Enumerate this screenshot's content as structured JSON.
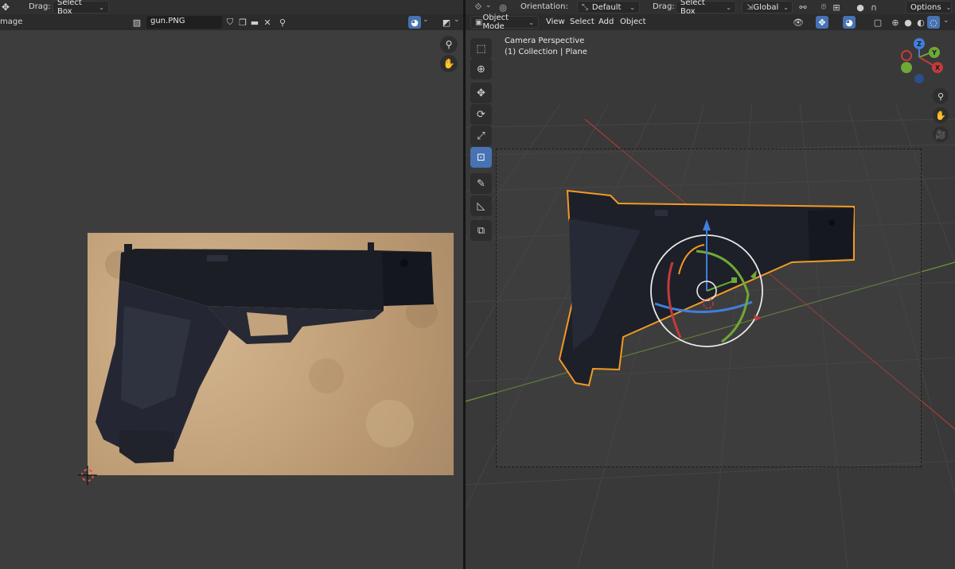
{
  "left_editor": {
    "drag_label": "Drag:",
    "drag_value": "Select Box",
    "editor_label": "mage",
    "image_name": "gun.PNG"
  },
  "right_viewport": {
    "orientation_label": "Orientation:",
    "orientation_value": "Default",
    "drag_label": "Drag:",
    "drag_value": "Select Box",
    "transform_space": "Global",
    "options_label": "Options",
    "mode": "Object Mode",
    "menus": [
      "View",
      "Select",
      "Add",
      "Object"
    ],
    "overlay_line1": "Camera Perspective",
    "overlay_line2": "(1) Collection | Plane",
    "gizmo": {
      "z_label": "Z",
      "y_label": "Y",
      "x_label": "X"
    }
  },
  "icons": {
    "move": "move-icon",
    "cursor": "cursor-icon",
    "rotate": "rotate-icon",
    "scale": "scale-icon",
    "transform": "transform-icon",
    "annotate": "annotate-icon",
    "measure": "measure-icon",
    "add_cube": "add-cube-icon",
    "zoom": "zoom-icon",
    "hand": "hand-icon",
    "camera": "camera-icon",
    "pin": "pin-icon"
  },
  "colors": {
    "accent_blue": "#4772b3",
    "selection_orange": "#f29a24",
    "axis_red": "#c43b3b",
    "axis_green": "#6fa837",
    "axis_blue": "#3f7fdc"
  }
}
